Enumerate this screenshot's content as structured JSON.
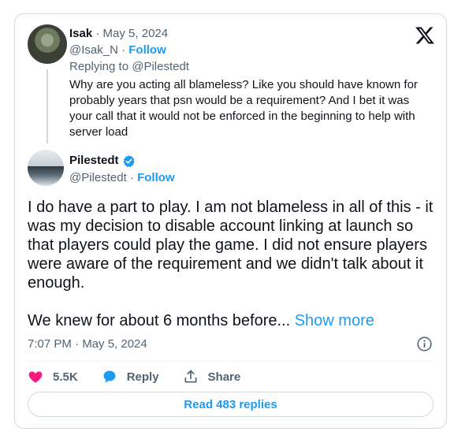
{
  "parent": {
    "name": "Isak",
    "date": "May 5, 2024",
    "handle": "@Isak_N",
    "follow_label": "Follow",
    "replying_prefix": "Replying to",
    "replying_handle": "@Pilestedt",
    "text": "Why are you acting all blameless? Like you should have known for probably years that psn would be a requirement? And I bet it was your call that it would not be enforced in the beginning to help with server load"
  },
  "main": {
    "name": "Pilestedt",
    "handle": "@Pilestedt",
    "follow_label": "Follow",
    "paragraph1": "I do have a part to play. I am not blameless in all of this - it was my decision to disable account linking at launch so that players could play the game. I did not ensure players were aware of the requirement and we didn't talk about it enough.",
    "paragraph2": "We knew for about 6 months before...",
    "show_more": "Show more",
    "timestamp": "7:07 PM · May 5, 2024"
  },
  "actions": {
    "likes": "5.5K",
    "reply_label": "Reply",
    "share_label": "Share",
    "read_replies": "Read 483 replies"
  },
  "colors": {
    "accent": "#1d9bf0",
    "like": "#f91880",
    "muted": "#536471"
  },
  "icons": [
    "x-logo-icon",
    "verified-badge-icon",
    "info-icon",
    "heart-icon",
    "reply-bubble-icon",
    "share-icon"
  ]
}
